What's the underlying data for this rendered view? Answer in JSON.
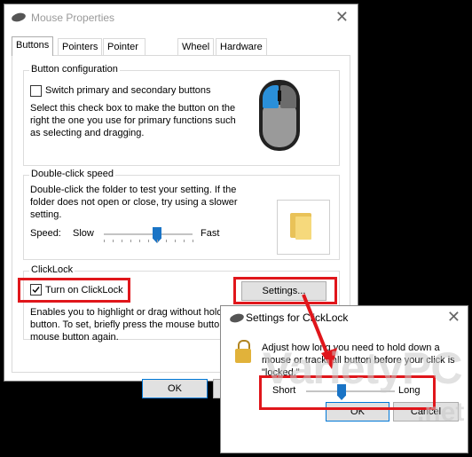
{
  "main_window": {
    "title": "Mouse Properties",
    "close": "✕",
    "tabs": [
      "Buttons",
      "Pointers",
      "Pointer Options",
      "Wheel",
      "Hardware"
    ],
    "button_config": {
      "label": "Button configuration",
      "checkbox_label": "Switch primary and secondary buttons",
      "desc_lines": [
        "Select this check box to make the button on the",
        "right the one you use for primary functions such",
        "as selecting and dragging."
      ]
    },
    "double_click": {
      "label": "Double-click speed",
      "desc_lines": [
        "Double-click the folder to test your setting. If the",
        "folder does not open or close, try using a slower",
        "setting."
      ],
      "speed_label": "Speed:",
      "slow": "Slow",
      "fast": "Fast",
      "value": 0.6
    },
    "clicklock": {
      "label": "ClickLock",
      "checkbox_label": "Turn on ClickLock",
      "checked": true,
      "settings_button": "Settings...",
      "desc_lines": [
        "Enables you to highlight or drag without holdi",
        "button. To set, briefly press the mouse button",
        "mouse button again."
      ]
    },
    "ok": "OK"
  },
  "dialog": {
    "title": "Settings for ClickLock",
    "close": "✕",
    "desc_lines": [
      "Adjust how long you need to hold down a",
      "mouse or trackball button before your click is",
      "\"locked.\""
    ],
    "short": "Short",
    "long": "Long",
    "value": 0.4,
    "ok": "OK",
    "cancel": "Cancel"
  },
  "watermark": {
    "brand": "VarietyPC",
    "suffix": ".net"
  },
  "colors": {
    "highlight": "#e0161b",
    "accent": "#1a74c6"
  }
}
